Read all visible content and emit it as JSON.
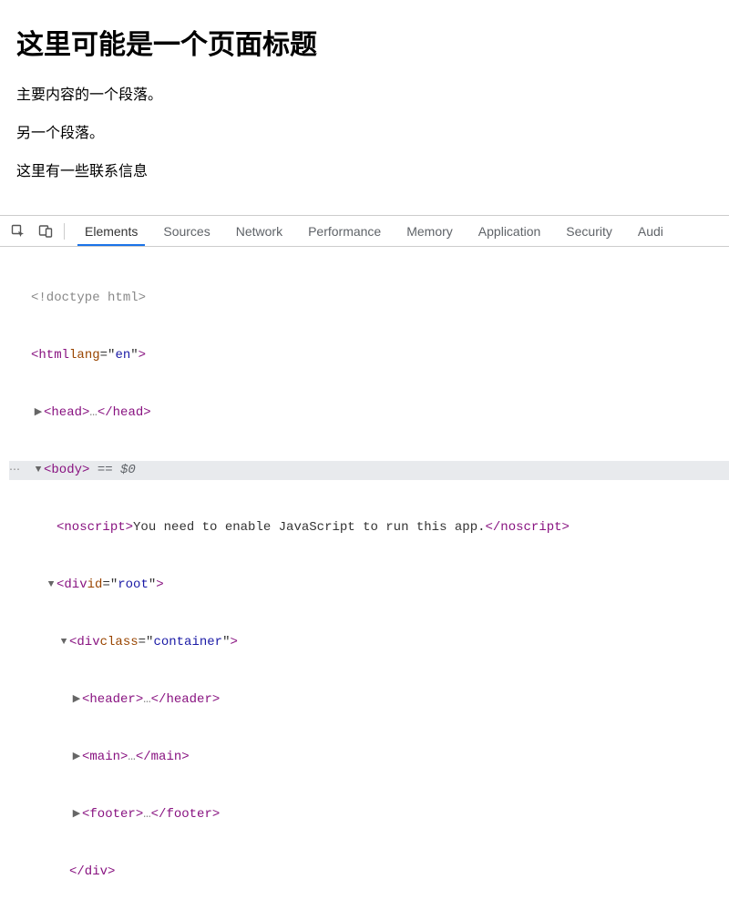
{
  "page": {
    "heading": "这里可能是一个页面标题",
    "para1": "主要内容的一个段落。",
    "para2": "另一个段落。",
    "contact": "这里有一些联系信息"
  },
  "devtools": {
    "tabs": {
      "elements": "Elements",
      "sources": "Sources",
      "network": "Network",
      "performance": "Performance",
      "memory": "Memory",
      "application": "Application",
      "security": "Security",
      "audits": "Audi"
    },
    "dom": {
      "doctype": "<!doctype html>",
      "html_open": "html",
      "html_lang_attr": "lang",
      "html_lang_val": "en",
      "head_open": "head",
      "head_ell": "…",
      "head_close": "/head",
      "body_open": "body",
      "body_eq": " == $0",
      "noscript_tag": "noscript",
      "noscript_text": "You need to enable JavaScript to run this app.",
      "noscript_close": "/noscript",
      "div_root": "div",
      "div_root_attr": "id",
      "div_root_val": "root",
      "div_container": "div",
      "div_container_attr": "class",
      "div_container_val": "container",
      "header_tag": "header",
      "main_tag": "main",
      "footer_tag": "footer",
      "ell": "…",
      "div_close": "/div"
    }
  }
}
